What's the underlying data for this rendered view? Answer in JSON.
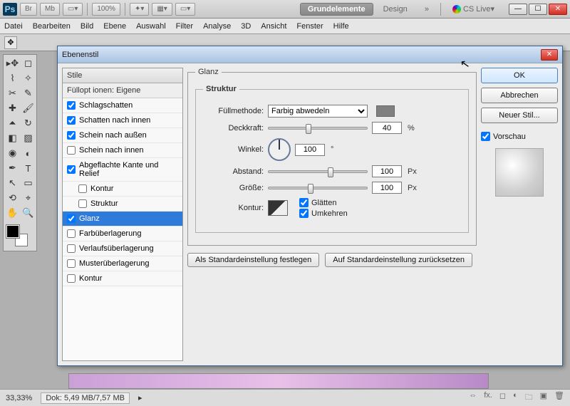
{
  "app": {
    "logo": "Ps",
    "zoom": "100%"
  },
  "workspace": {
    "tabs": [
      "Grundelemente",
      "Design"
    ],
    "active": 0,
    "cslive": "CS Live"
  },
  "menu": [
    "Datei",
    "Bearbeiten",
    "Bild",
    "Ebene",
    "Auswahl",
    "Filter",
    "Analyse",
    "3D",
    "Ansicht",
    "Fenster",
    "Hilfe"
  ],
  "dialog": {
    "title": "Ebenenstil",
    "styles_header": "Stile",
    "blend_header": "Füllopt ionen: Eigene",
    "items": [
      {
        "label": "Schlagschatten",
        "checked": true
      },
      {
        "label": "Schatten nach innen",
        "checked": true
      },
      {
        "label": "Schein nach außen",
        "checked": true
      },
      {
        "label": "Schein nach innen",
        "checked": false
      },
      {
        "label": "Abgeflachte Kante und Relief",
        "checked": true
      },
      {
        "label": "Kontur",
        "checked": false,
        "indent": true
      },
      {
        "label": "Struktur",
        "checked": false,
        "indent": true
      },
      {
        "label": "Glanz",
        "checked": true,
        "selected": true
      },
      {
        "label": "Farbüberlagerung",
        "checked": false
      },
      {
        "label": "Verlaufsüberlagerung",
        "checked": false
      },
      {
        "label": "Musterüberlagerung",
        "checked": false
      },
      {
        "label": "Kontur",
        "checked": false
      }
    ],
    "outer_legend": "Glanz",
    "inner_legend": "Struktur",
    "fields": {
      "blendmode_label": "Füllmethode:",
      "blendmode_value": "Farbig abwedeln",
      "opacity_label": "Deckkraft:",
      "opacity_value": "40",
      "opacity_unit": "%",
      "angle_label": "Winkel:",
      "angle_value": "100",
      "angle_unit": "°",
      "distance_label": "Abstand:",
      "distance_value": "100",
      "distance_unit": "Px",
      "size_label": "Größe:",
      "size_value": "100",
      "size_unit": "Px",
      "contour_label": "Kontur:",
      "antialias": "Glätten",
      "invert": "Umkehren"
    },
    "buttons": {
      "make_default": "Als Standardeinstellung festlegen",
      "reset_default": "Auf Standardeinstellung zurücksetzen",
      "ok": "OK",
      "cancel": "Abbrechen",
      "new_style": "Neuer Stil...",
      "preview": "Vorschau"
    }
  },
  "status": {
    "zoom": "33,33%",
    "doc": "Dok: 5,49 MB/7,57 MB"
  }
}
